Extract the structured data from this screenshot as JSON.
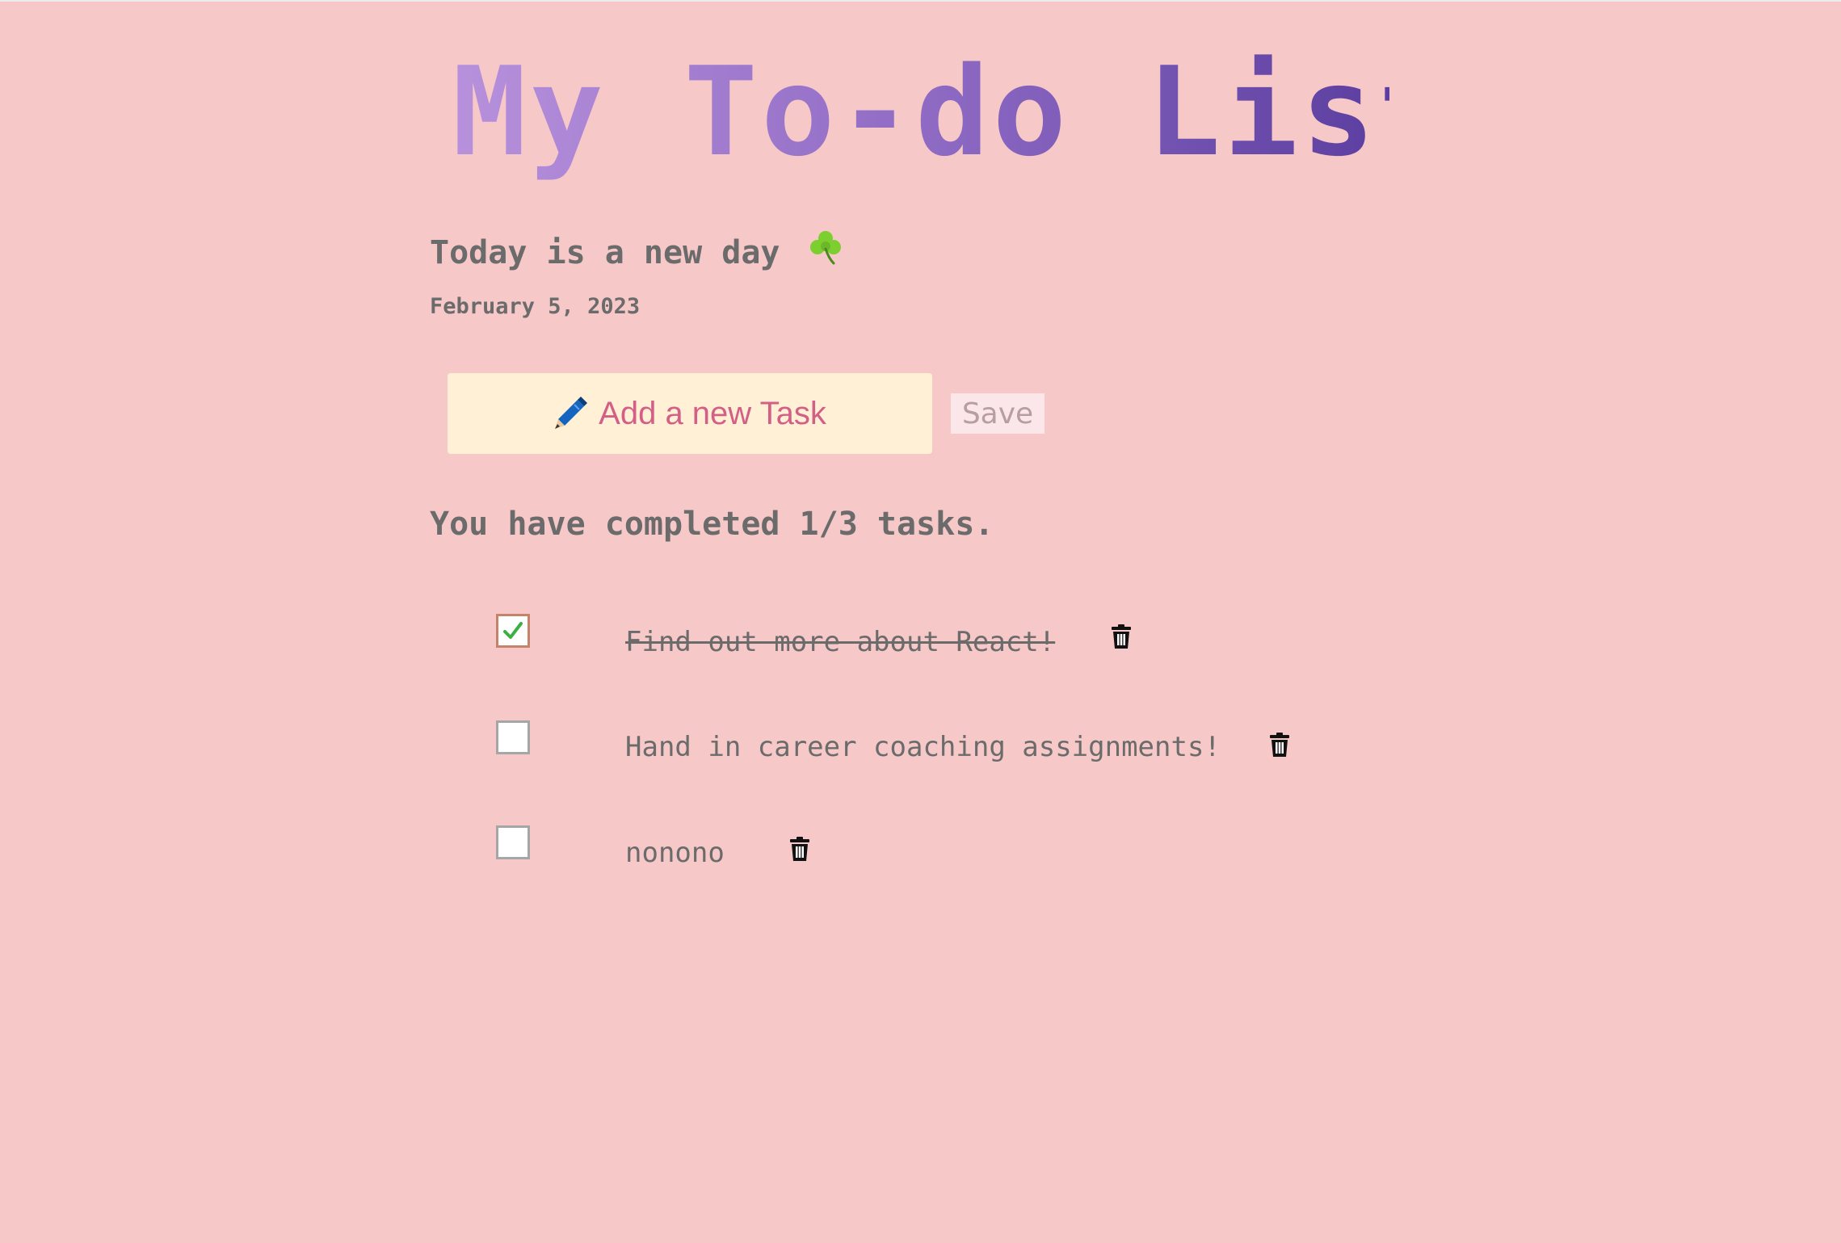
{
  "header": {
    "title": "My To-do List"
  },
  "greeting": {
    "text": "Today is a new day",
    "icon": "shamrock-icon"
  },
  "date": "February 5, 2023",
  "new_task": {
    "placeholder": "Add a new Task",
    "icon": "pen-icon",
    "save_label": "Save"
  },
  "summary": "You have completed 1/3 tasks.",
  "tasks": [
    {
      "text": "Find out more about React!",
      "completed": true
    },
    {
      "text": "Hand in career coaching assignments!",
      "completed": false
    },
    {
      "text": "nonono",
      "completed": false
    }
  ],
  "colors": {
    "background": "#f7c8c8",
    "title_gradient": [
      "#b791dc",
      "#5b3ea0"
    ],
    "input_background": "#fff0d6",
    "placeholder": "#d35f87",
    "text": "#6b6b6b",
    "check": "#3cb043"
  }
}
